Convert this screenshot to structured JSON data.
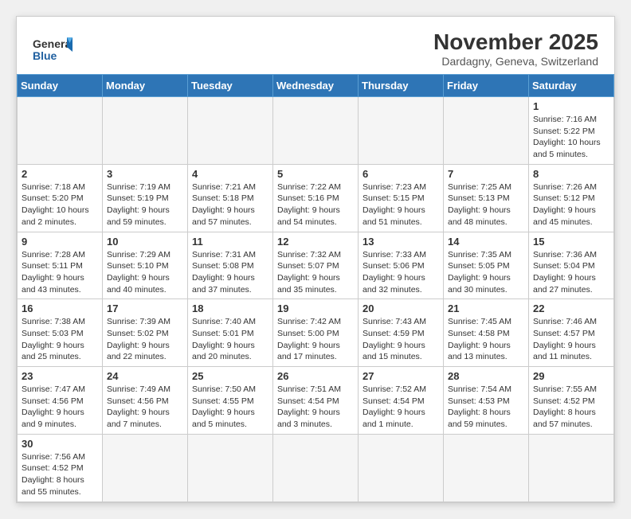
{
  "header": {
    "logo_general": "General",
    "logo_blue": "Blue",
    "month_year": "November 2025",
    "location": "Dardagny, Geneva, Switzerland"
  },
  "days_of_week": [
    "Sunday",
    "Monday",
    "Tuesday",
    "Wednesday",
    "Thursday",
    "Friday",
    "Saturday"
  ],
  "weeks": [
    [
      {
        "day": "",
        "info": ""
      },
      {
        "day": "",
        "info": ""
      },
      {
        "day": "",
        "info": ""
      },
      {
        "day": "",
        "info": ""
      },
      {
        "day": "",
        "info": ""
      },
      {
        "day": "",
        "info": ""
      },
      {
        "day": "1",
        "info": "Sunrise: 7:16 AM\nSunset: 5:22 PM\nDaylight: 10 hours and 5 minutes."
      }
    ],
    [
      {
        "day": "2",
        "info": "Sunrise: 7:18 AM\nSunset: 5:20 PM\nDaylight: 10 hours and 2 minutes."
      },
      {
        "day": "3",
        "info": "Sunrise: 7:19 AM\nSunset: 5:19 PM\nDaylight: 9 hours and 59 minutes."
      },
      {
        "day": "4",
        "info": "Sunrise: 7:21 AM\nSunset: 5:18 PM\nDaylight: 9 hours and 57 minutes."
      },
      {
        "day": "5",
        "info": "Sunrise: 7:22 AM\nSunset: 5:16 PM\nDaylight: 9 hours and 54 minutes."
      },
      {
        "day": "6",
        "info": "Sunrise: 7:23 AM\nSunset: 5:15 PM\nDaylight: 9 hours and 51 minutes."
      },
      {
        "day": "7",
        "info": "Sunrise: 7:25 AM\nSunset: 5:13 PM\nDaylight: 9 hours and 48 minutes."
      },
      {
        "day": "8",
        "info": "Sunrise: 7:26 AM\nSunset: 5:12 PM\nDaylight: 9 hours and 45 minutes."
      }
    ],
    [
      {
        "day": "9",
        "info": "Sunrise: 7:28 AM\nSunset: 5:11 PM\nDaylight: 9 hours and 43 minutes."
      },
      {
        "day": "10",
        "info": "Sunrise: 7:29 AM\nSunset: 5:10 PM\nDaylight: 9 hours and 40 minutes."
      },
      {
        "day": "11",
        "info": "Sunrise: 7:31 AM\nSunset: 5:08 PM\nDaylight: 9 hours and 37 minutes."
      },
      {
        "day": "12",
        "info": "Sunrise: 7:32 AM\nSunset: 5:07 PM\nDaylight: 9 hours and 35 minutes."
      },
      {
        "day": "13",
        "info": "Sunrise: 7:33 AM\nSunset: 5:06 PM\nDaylight: 9 hours and 32 minutes."
      },
      {
        "day": "14",
        "info": "Sunrise: 7:35 AM\nSunset: 5:05 PM\nDaylight: 9 hours and 30 minutes."
      },
      {
        "day": "15",
        "info": "Sunrise: 7:36 AM\nSunset: 5:04 PM\nDaylight: 9 hours and 27 minutes."
      }
    ],
    [
      {
        "day": "16",
        "info": "Sunrise: 7:38 AM\nSunset: 5:03 PM\nDaylight: 9 hours and 25 minutes."
      },
      {
        "day": "17",
        "info": "Sunrise: 7:39 AM\nSunset: 5:02 PM\nDaylight: 9 hours and 22 minutes."
      },
      {
        "day": "18",
        "info": "Sunrise: 7:40 AM\nSunset: 5:01 PM\nDaylight: 9 hours and 20 minutes."
      },
      {
        "day": "19",
        "info": "Sunrise: 7:42 AM\nSunset: 5:00 PM\nDaylight: 9 hours and 17 minutes."
      },
      {
        "day": "20",
        "info": "Sunrise: 7:43 AM\nSunset: 4:59 PM\nDaylight: 9 hours and 15 minutes."
      },
      {
        "day": "21",
        "info": "Sunrise: 7:45 AM\nSunset: 4:58 PM\nDaylight: 9 hours and 13 minutes."
      },
      {
        "day": "22",
        "info": "Sunrise: 7:46 AM\nSunset: 4:57 PM\nDaylight: 9 hours and 11 minutes."
      }
    ],
    [
      {
        "day": "23",
        "info": "Sunrise: 7:47 AM\nSunset: 4:56 PM\nDaylight: 9 hours and 9 minutes."
      },
      {
        "day": "24",
        "info": "Sunrise: 7:49 AM\nSunset: 4:56 PM\nDaylight: 9 hours and 7 minutes."
      },
      {
        "day": "25",
        "info": "Sunrise: 7:50 AM\nSunset: 4:55 PM\nDaylight: 9 hours and 5 minutes."
      },
      {
        "day": "26",
        "info": "Sunrise: 7:51 AM\nSunset: 4:54 PM\nDaylight: 9 hours and 3 minutes."
      },
      {
        "day": "27",
        "info": "Sunrise: 7:52 AM\nSunset: 4:54 PM\nDaylight: 9 hours and 1 minute."
      },
      {
        "day": "28",
        "info": "Sunrise: 7:54 AM\nSunset: 4:53 PM\nDaylight: 8 hours and 59 minutes."
      },
      {
        "day": "29",
        "info": "Sunrise: 7:55 AM\nSunset: 4:52 PM\nDaylight: 8 hours and 57 minutes."
      }
    ],
    [
      {
        "day": "30",
        "info": "Sunrise: 7:56 AM\nSunset: 4:52 PM\nDaylight: 8 hours and 55 minutes."
      },
      {
        "day": "",
        "info": ""
      },
      {
        "day": "",
        "info": ""
      },
      {
        "day": "",
        "info": ""
      },
      {
        "day": "",
        "info": ""
      },
      {
        "day": "",
        "info": ""
      },
      {
        "day": "",
        "info": ""
      }
    ]
  ]
}
